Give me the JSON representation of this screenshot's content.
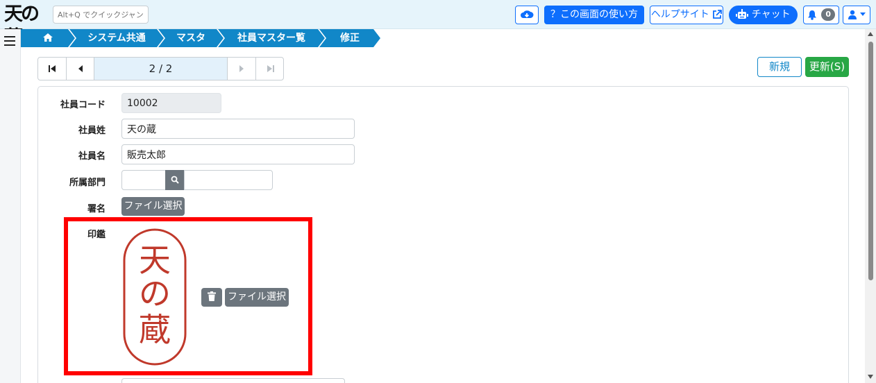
{
  "header": {
    "logo_text": "天の蔵",
    "quick_jump_placeholder": "Alt+Q でクイックジャンプ",
    "usage_label": "？この画面の使い方",
    "help_label": "ヘルプサイト",
    "chat_label": "チャット",
    "notification_count": "0"
  },
  "breadcrumb": [
    "システム共通",
    "マスタ",
    "社員マスター覧",
    "修正"
  ],
  "pager": {
    "position": "2 / 2"
  },
  "actions": {
    "new_label": "新規",
    "update_label": "更新(S)"
  },
  "form": {
    "employee_code": {
      "label": "社員コード",
      "value": "10002"
    },
    "last_name": {
      "label": "社員姓",
      "value": "天の蔵"
    },
    "first_name": {
      "label": "社員名",
      "value": "販売太郎"
    },
    "department": {
      "label": "所属部門",
      "value": ""
    },
    "signature": {
      "label": "署名",
      "button": "ファイル選択"
    },
    "seal": {
      "label": "印鑑",
      "image_text": [
        "天",
        "の",
        "蔵"
      ],
      "button": "ファイル選択"
    }
  },
  "colors": {
    "primary": "#0d6efd",
    "breadcrumb": "#1187c8",
    "success": "#28a745",
    "secondary": "#6c757d",
    "highlight": "#ff0000",
    "seal_red": "#c0392b"
  },
  "icons": [
    "cloud-download-icon",
    "external-link-icon",
    "robot-icon",
    "bell-icon",
    "user-icon",
    "home-icon",
    "search-icon",
    "trash-icon",
    "menu-icon"
  ]
}
